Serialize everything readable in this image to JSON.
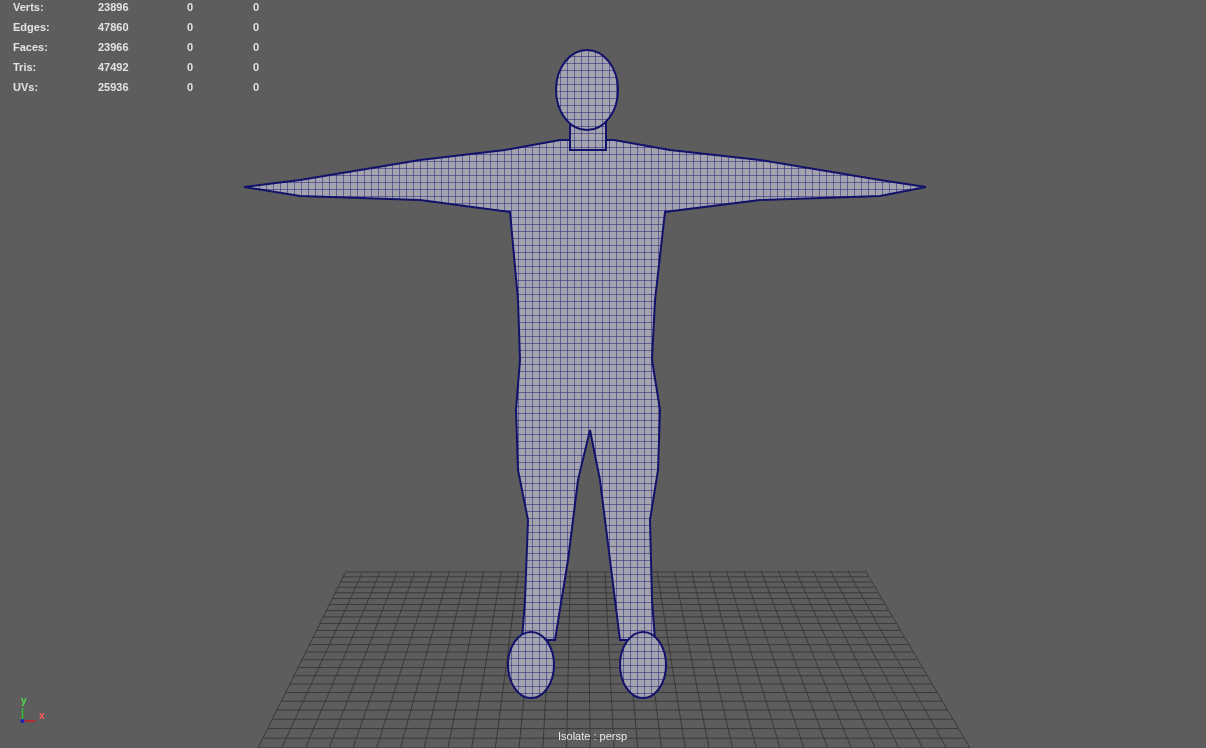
{
  "hud_stats": [
    {
      "label": "Verts:",
      "values": [
        "23896",
        "0",
        "0"
      ]
    },
    {
      "label": "Edges:",
      "values": [
        "47860",
        "0",
        "0"
      ]
    },
    {
      "label": "Faces:",
      "values": [
        "23966",
        "0",
        "0"
      ]
    },
    {
      "label": "Tris:",
      "values": [
        "47492",
        "0",
        "0"
      ]
    },
    {
      "label": "UVs:",
      "values": [
        "25936",
        "0",
        "0"
      ]
    }
  ],
  "axis_gizmo": {
    "y_label": "y",
    "x_label": "x"
  },
  "camera_label": "Isolate : persp"
}
